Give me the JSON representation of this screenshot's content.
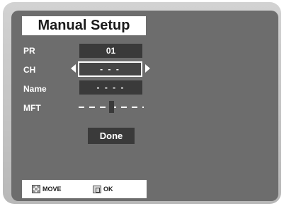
{
  "title": "Manual Setup",
  "fields": {
    "pr": {
      "label": "PR",
      "value": "01"
    },
    "ch": {
      "label": "CH",
      "value": "- - -"
    },
    "name": {
      "label": "Name",
      "value": "- - - -"
    },
    "mft": {
      "label": "MFT",
      "level": 0.5
    }
  },
  "done_label": "Done",
  "help": {
    "move_label": "MOVE",
    "ok_label": "OK"
  },
  "colors": {
    "panel": "#6d6d6d",
    "value_box": "#3a3a3a",
    "frame": "#c4c4c4"
  }
}
